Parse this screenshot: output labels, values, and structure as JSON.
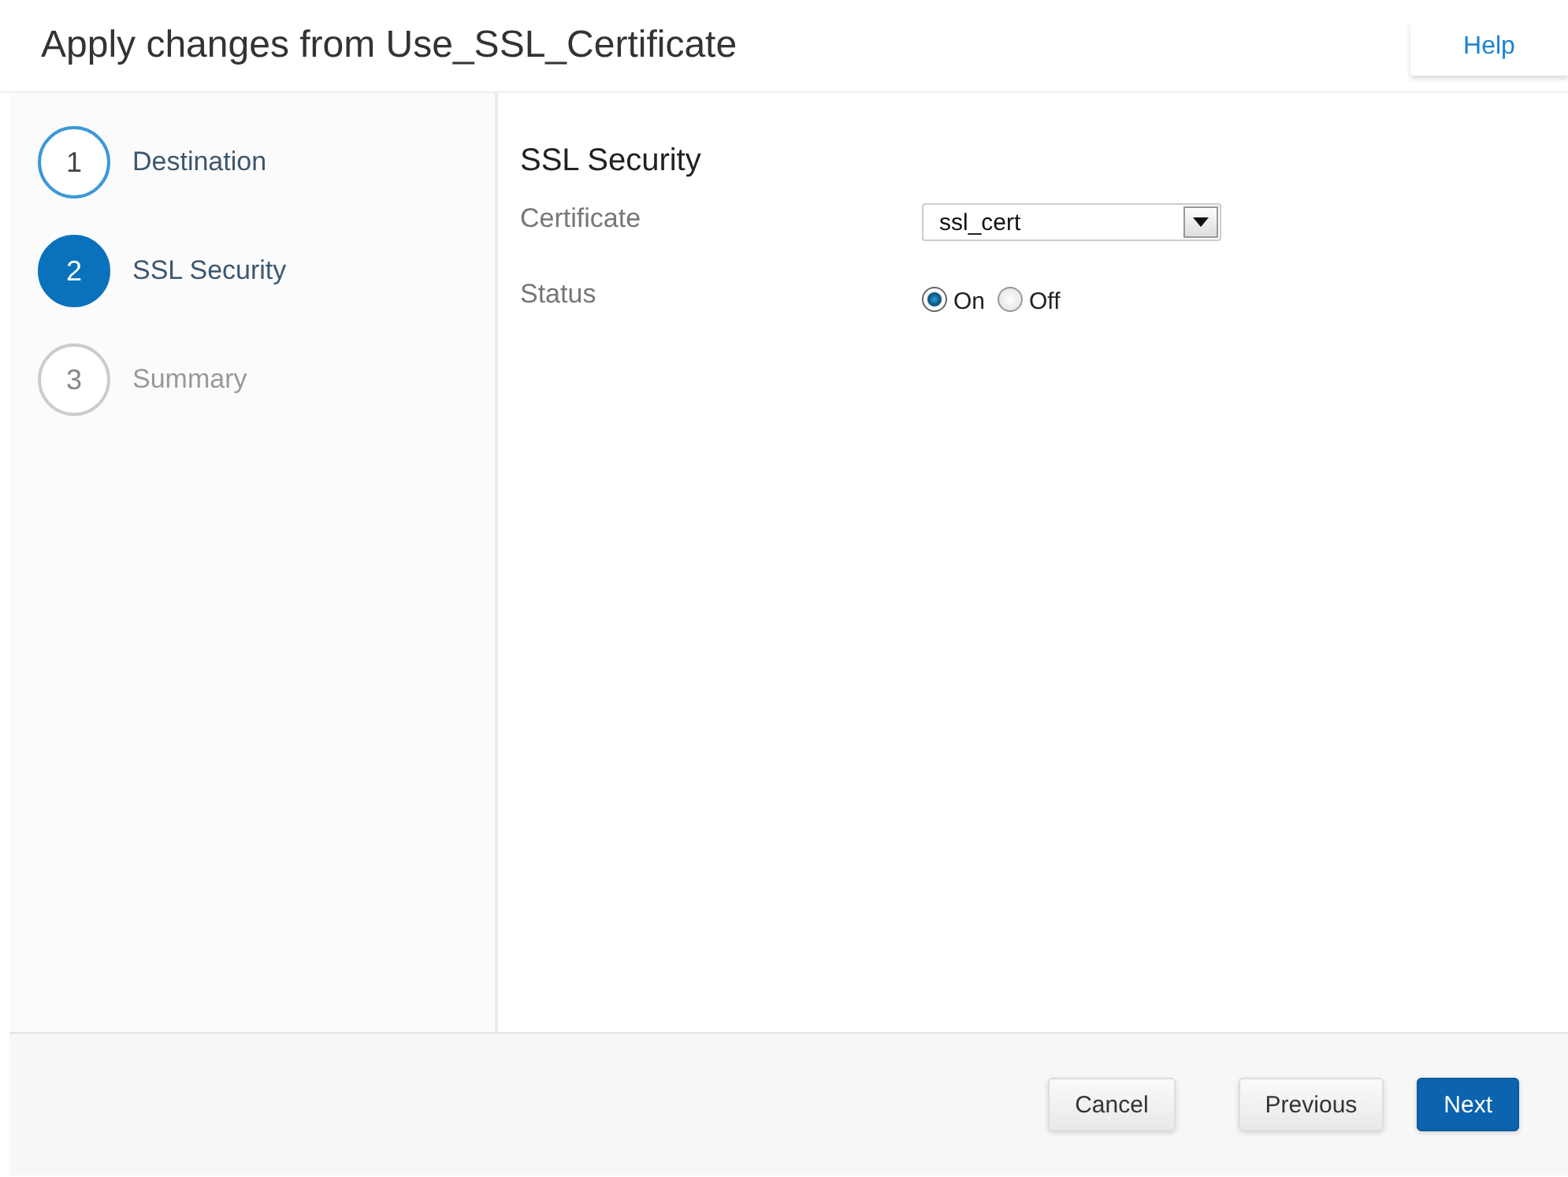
{
  "header": {
    "title": "Apply changes from Use_SSL_Certificate",
    "help_button": "Help"
  },
  "steps": [
    {
      "number": "1",
      "label": "Destination",
      "completed": true,
      "selected": false
    },
    {
      "number": "2",
      "label": "SSL Security",
      "completed": false,
      "selected": true
    },
    {
      "number": "3",
      "label": "Summary",
      "completed": false,
      "selected": false
    }
  ],
  "section": {
    "title": "SSL Security",
    "fields": [
      {
        "kind": "select",
        "label": "Certificate",
        "value": "ssl_cert"
      },
      {
        "kind": "radio",
        "label": "Status",
        "options": [
          {
            "label": "On",
            "selected": true
          },
          {
            "label": "Off",
            "selected": false
          }
        ]
      }
    ]
  },
  "footer": {
    "buttons": [
      {
        "label": "Cancel",
        "kind": "secondary"
      },
      {
        "label": "Previous",
        "kind": "secondary"
      },
      {
        "label": "Next",
        "kind": "primary"
      }
    ]
  }
}
